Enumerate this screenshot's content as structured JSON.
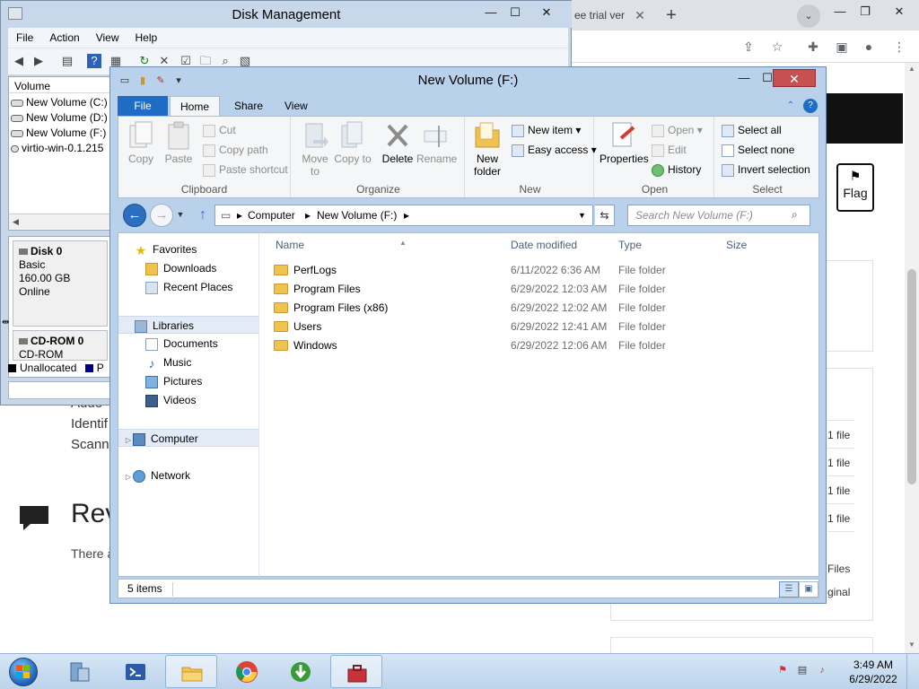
{
  "browser": {
    "tab_title": "ee trial ver",
    "tab_close_glyph": "✕",
    "new_tab_glyph": "+",
    "tab_search_glyph": "⌄",
    "flag_label": "Flag",
    "page_texts": [
      "Adde",
      "Identif",
      "Scann"
    ],
    "review_heading": "Rev",
    "there_text": "There a",
    "file_rows": [
      "1 file",
      "1 file",
      "1 file",
      "1 file"
    ],
    "files_text": "Files",
    "ginal_text": "ginal",
    "icons": [
      "share-icon",
      "star-icon",
      "extensions-icon",
      "sidepanel-icon",
      "profile-icon",
      "menu-icon"
    ]
  },
  "disk_mgmt": {
    "title": "Disk Management",
    "menus": [
      "File",
      "Action",
      "View",
      "Help"
    ],
    "volume_header": "Volume",
    "volumes": [
      "New Volume (C:)",
      "New Volume (D:)",
      "New Volume (F:)",
      "virtio-win-0.1.215"
    ],
    "disks": [
      {
        "name": "Disk 0",
        "type": "Basic",
        "size": "160.00 GB",
        "status": "Online"
      },
      {
        "name": "CD-ROM 0",
        "type": "CD-ROM"
      }
    ],
    "legend": [
      {
        "label": "Unallocated",
        "color": "#000000"
      },
      {
        "label": "P",
        "color": "#000080"
      }
    ]
  },
  "explorer": {
    "title": "New Volume (F:)",
    "ribbon_tabs": [
      "File",
      "Home",
      "Share",
      "View"
    ],
    "clipboard": {
      "group_label": "Clipboard",
      "copy": "Copy",
      "paste": "Paste",
      "cut": "Cut",
      "copy_path": "Copy path",
      "paste_shortcut": "Paste shortcut"
    },
    "organize": {
      "group_label": "Organize",
      "move_to": "Move to",
      "copy_to": "Copy to",
      "delete": "Delete",
      "rename": "Rename"
    },
    "new": {
      "group_label": "New",
      "new_folder": "New folder",
      "new_item": "New item",
      "easy_access": "Easy access"
    },
    "open": {
      "group_label": "Open",
      "properties": "Properties",
      "open": "Open",
      "edit": "Edit",
      "history": "History"
    },
    "select": {
      "group_label": "Select",
      "select_all": "Select all",
      "select_none": "Select none",
      "invert_selection": "Invert selection"
    },
    "address": [
      "Computer",
      "New Volume (F:)"
    ],
    "search_placeholder": "Search New Volume (F:)",
    "nav": {
      "favorites": "Favorites",
      "downloads": "Downloads",
      "recent_places": "Recent Places",
      "libraries": "Libraries",
      "documents": "Documents",
      "music": "Music",
      "pictures": "Pictures",
      "videos": "Videos",
      "computer": "Computer",
      "network": "Network"
    },
    "columns": {
      "name": "Name",
      "date_modified": "Date modified",
      "type": "Type",
      "size": "Size"
    },
    "files": [
      {
        "name": "PerfLogs",
        "date": "6/11/2022 6:36 AM",
        "type": "File folder"
      },
      {
        "name": "Program Files",
        "date": "6/29/2022 12:03 AM",
        "type": "File folder"
      },
      {
        "name": "Program Files (x86)",
        "date": "6/29/2022 12:02 AM",
        "type": "File folder"
      },
      {
        "name": "Users",
        "date": "6/29/2022 12:41 AM",
        "type": "File folder"
      },
      {
        "name": "Windows",
        "date": "6/29/2022 12:06 AM",
        "type": "File folder"
      }
    ],
    "status_items": "5 items"
  },
  "taskbar": {
    "time": "3:49 AM",
    "date": "6/29/2022",
    "apps": [
      "server-manager-icon",
      "powershell-icon",
      "file-explorer-icon",
      "chrome-icon",
      "download-manager-icon",
      "toolbox-icon"
    ]
  }
}
